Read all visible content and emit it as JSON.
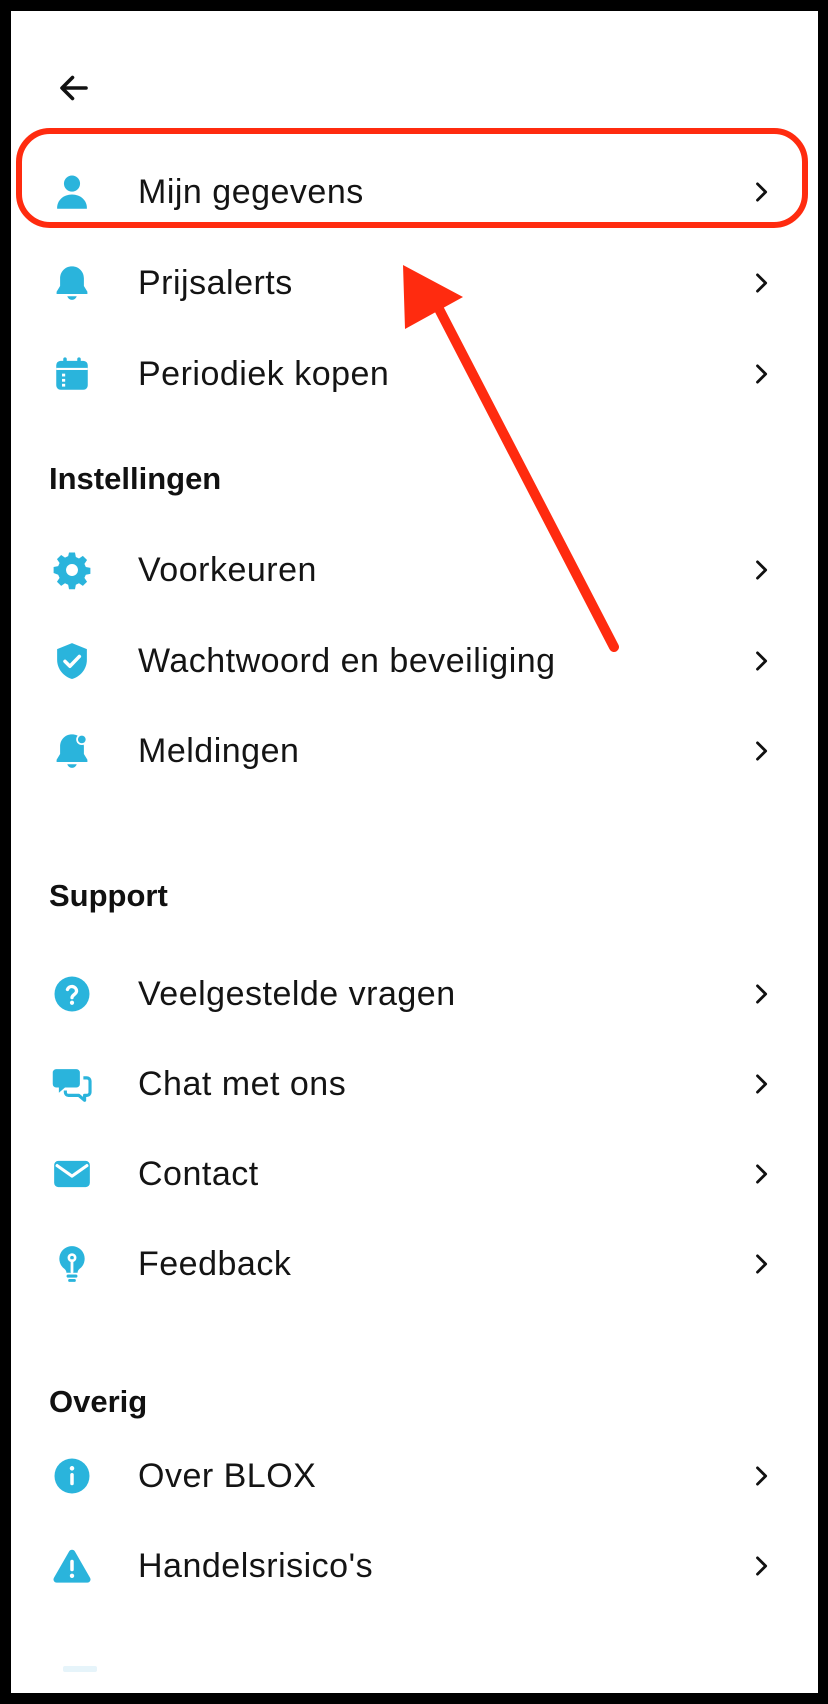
{
  "colors": {
    "icon_accent": "#2ab4dc",
    "annotation": "#ff2b0f",
    "text": "#141414"
  },
  "header": {
    "back_icon": "arrow-left-icon"
  },
  "account_items": [
    {
      "label": "Mijn gegevens",
      "icon": "user-icon"
    },
    {
      "label": "Prijsalerts",
      "icon": "bell-icon"
    },
    {
      "label": "Periodiek kopen",
      "icon": "calendar-icon"
    }
  ],
  "sections": {
    "instellingen": {
      "title": "Instellingen",
      "items": [
        {
          "label": "Voorkeuren",
          "icon": "gear-icon"
        },
        {
          "label": "Wachtwoord en beveiliging",
          "icon": "shield-check-icon"
        },
        {
          "label": "Meldingen",
          "icon": "notification-bell-icon"
        }
      ]
    },
    "support": {
      "title": "Support",
      "items": [
        {
          "label": "Veelgestelde vragen",
          "icon": "question-icon"
        },
        {
          "label": "Chat met ons",
          "icon": "chat-bubbles-icon"
        },
        {
          "label": "Contact",
          "icon": "mail-icon"
        },
        {
          "label": "Feedback",
          "icon": "lightbulb-icon"
        }
      ]
    },
    "overig": {
      "title": "Overig",
      "items": [
        {
          "label": "Over BLOX",
          "icon": "info-icon"
        },
        {
          "label": "Handelsrisico's",
          "icon": "warning-icon"
        }
      ]
    }
  }
}
